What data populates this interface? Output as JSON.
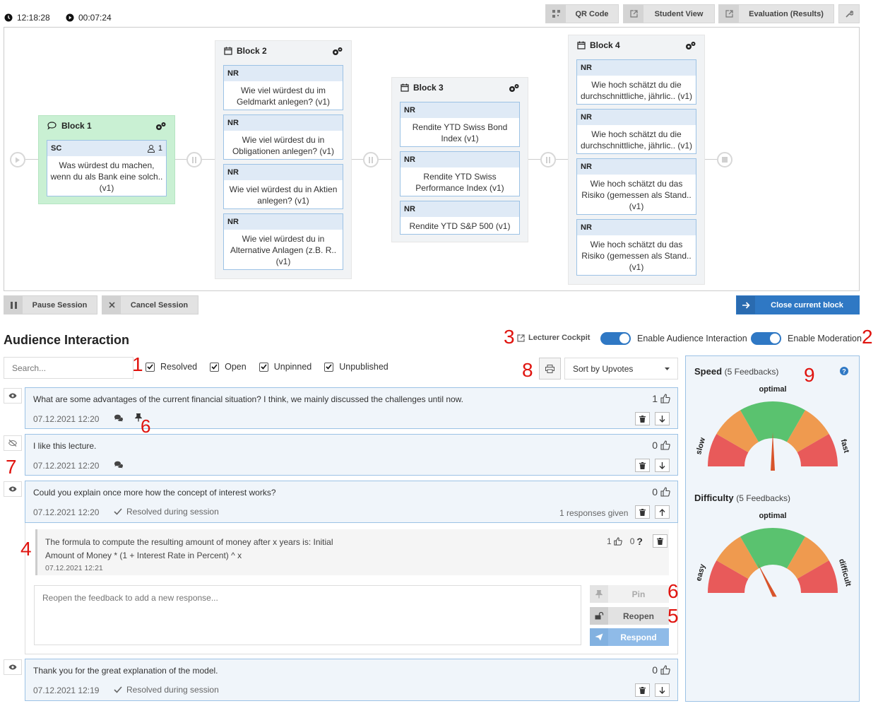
{
  "topbar": {
    "clock": "12:18:28",
    "timer": "00:07:24",
    "buttons": [
      "QR Code",
      "Student View",
      "Evaluation (Results)"
    ]
  },
  "blocks": [
    {
      "title": "Block 1",
      "questions": [
        {
          "type": "SC",
          "text": "Was würdest du machen, wenn du als Bank eine solch.. (v1)",
          "participants": "1"
        }
      ]
    },
    {
      "title": "Block 2",
      "questions": [
        {
          "type": "NR",
          "text": "Wie viel würdest du im Geldmarkt anlegen? (v1)"
        },
        {
          "type": "NR",
          "text": "Wie viel würdest du in Obligationen anlegen? (v1)"
        },
        {
          "type": "NR",
          "text": "Wie viel würdest du in Aktien anlegen? (v1)"
        },
        {
          "type": "NR",
          "text": "Wie viel würdest du in Alternative Anlagen (z.B. R.. (v1)"
        }
      ]
    },
    {
      "title": "Block 3",
      "questions": [
        {
          "type": "NR",
          "text": "Rendite YTD Swiss Bond Index (v1)"
        },
        {
          "type": "NR",
          "text": "Rendite YTD Swiss Performance Index (v1)"
        },
        {
          "type": "NR",
          "text": "Rendite YTD S&P 500 (v1)"
        }
      ]
    },
    {
      "title": "Block 4",
      "questions": [
        {
          "type": "NR",
          "text": "Wie hoch schätzt du die durchschnittliche, jährlic.. (v1)"
        },
        {
          "type": "NR",
          "text": "Wie hoch schätzt du die durchschnittliche, jährlic.. (v1)"
        },
        {
          "type": "NR",
          "text": "Wie hoch schätzt du das Risiko (gemessen als Stand.. (v1)"
        },
        {
          "type": "NR",
          "text": "Wie hoch schätzt du das Risiko (gemessen als Stand.. (v1)"
        }
      ]
    }
  ],
  "session": {
    "pause": "Pause Session",
    "cancel": "Cancel Session",
    "close_block": "Close current block"
  },
  "audience": {
    "title": "Audience Interaction",
    "lecturer_cockpit": "Lecturer Cockpit",
    "enable_interaction": "Enable Audience Interaction",
    "enable_moderation": "Enable Moderation",
    "search_placeholder": "Search...",
    "filters": [
      "Resolved",
      "Open",
      "Unpinned",
      "Unpublished"
    ],
    "sort": "Sort by Upvotes"
  },
  "annotations": [
    "1",
    "2",
    "3",
    "4",
    "5",
    "6",
    "6",
    "7",
    "8",
    "9"
  ],
  "feedbacks": [
    {
      "text": "What are some advantages of the current financial situation? I think, we mainly discussed the challenges until now.",
      "date": "07.12.2021 12:20",
      "votes": "1"
    },
    {
      "text": "I like this lecture.",
      "date": "07.12.2021 12:20",
      "votes": "0"
    },
    {
      "text": "Could you explain once more how the concept of interest works?",
      "date": "07.12.2021 12:20",
      "votes": "0",
      "status": "Resolved during session",
      "responses": "1 responses given"
    },
    {
      "text": "Thank you for the great explanation of the model.",
      "date": "07.12.2021 12:19",
      "votes": "0",
      "status": "Resolved during session"
    }
  ],
  "response": {
    "text_line1": "The formula to compute the resulting amount of money after x years is: Initial",
    "text_line2": "Amount of Money * (1 + Interest Rate in Percent) ^ x",
    "date": "07.12.2021 12:21",
    "upvotes": "1",
    "downvotes": "0",
    "placeholder": "Reopen the feedback to add a new response...",
    "pin": "Pin",
    "reopen": "Reopen",
    "respond": "Respond"
  },
  "speed": {
    "title": "Speed",
    "count": "(5 Feedbacks)",
    "optimal": "optimal",
    "low": "slow",
    "high": "fast",
    "value": 0.5
  },
  "difficulty": {
    "title": "Difficulty",
    "count": "(5 Feedbacks)",
    "optimal": "optimal",
    "low": "easy",
    "high": "difficult",
    "value": 0.35
  },
  "colors": {
    "accent": "#2f78c4",
    "active_block": "#c9f0d3",
    "gauge_low": "#e85a5a",
    "gauge_mid": "#ef9a4f",
    "gauge_opt": "#5ac26f",
    "needle": "#d8542b"
  }
}
